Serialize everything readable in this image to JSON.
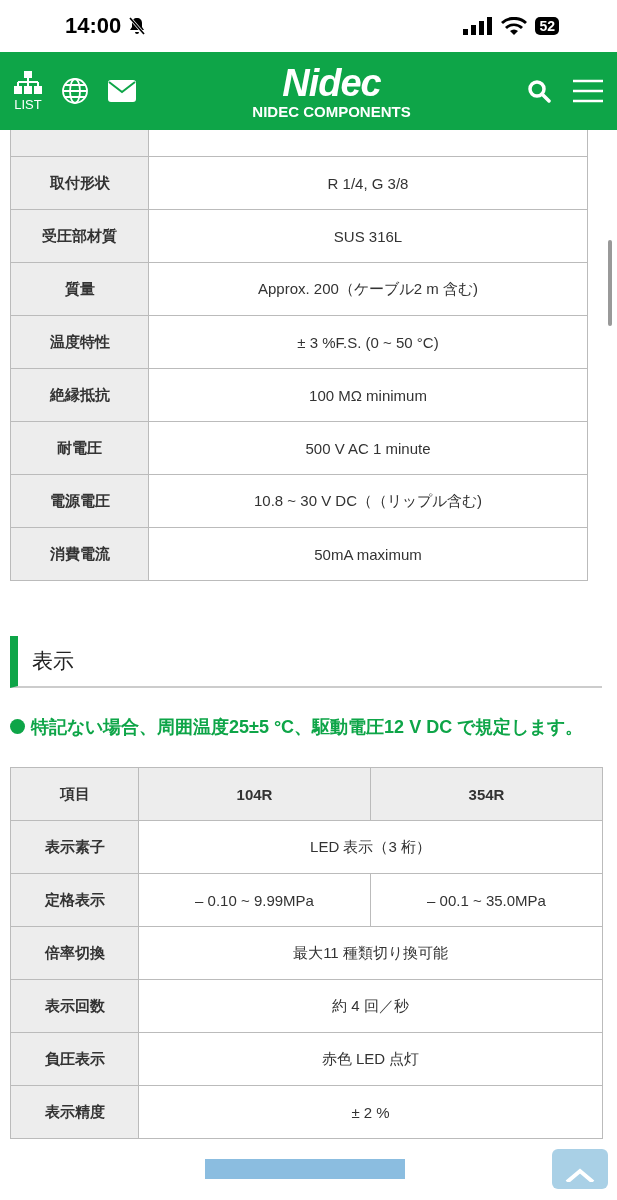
{
  "status_bar": {
    "time": "14:00",
    "silent": true,
    "battery": "52"
  },
  "header": {
    "list_label": "LIST",
    "logo": "Nidec",
    "subtitle": "NIDEC COMPONENTS"
  },
  "spec_table": {
    "rows": [
      {
        "label": "取付形状",
        "value": "R 1/4, G 3/8"
      },
      {
        "label": "受圧部材質",
        "value": "SUS 316L"
      },
      {
        "label": "質量",
        "value": "Approx. 200（ケーブル2 m 含む)"
      },
      {
        "label": "温度特性",
        "value": "± 3 %F.S. (0 ~ 50 °C)"
      },
      {
        "label": "絶縁抵抗",
        "value": "100 MΩ minimum"
      },
      {
        "label": "耐電圧",
        "value": "500 V AC 1 minute"
      },
      {
        "label": "電源電圧",
        "value": "10.8 ~ 30 V DC（（リップル含む)"
      },
      {
        "label": "消費電流",
        "value": "50mA maximum"
      }
    ]
  },
  "section": {
    "title": "表示",
    "note": "特記ない場合、周囲温度25±5 °C、駆動電圧12 V DC で規定します。"
  },
  "display_table": {
    "columns": [
      "項目",
      "104R",
      "354R"
    ],
    "rows": [
      {
        "label": "表示素子",
        "values": [
          "LED 表示（3 桁）"
        ]
      },
      {
        "label": "定格表示",
        "values": [
          "– 0.10 ~ 9.99MPa",
          "– 00.1 ~ 35.0MPa"
        ]
      },
      {
        "label": "倍率切換",
        "values": [
          "最大11 種類切り換可能"
        ]
      },
      {
        "label": "表示回数",
        "values": [
          "約 4 回／秒"
        ]
      },
      {
        "label": "負圧表示",
        "values": [
          "赤色 LED 点灯"
        ]
      },
      {
        "label": "表示精度",
        "values": [
          "± 2 %"
        ]
      }
    ]
  }
}
